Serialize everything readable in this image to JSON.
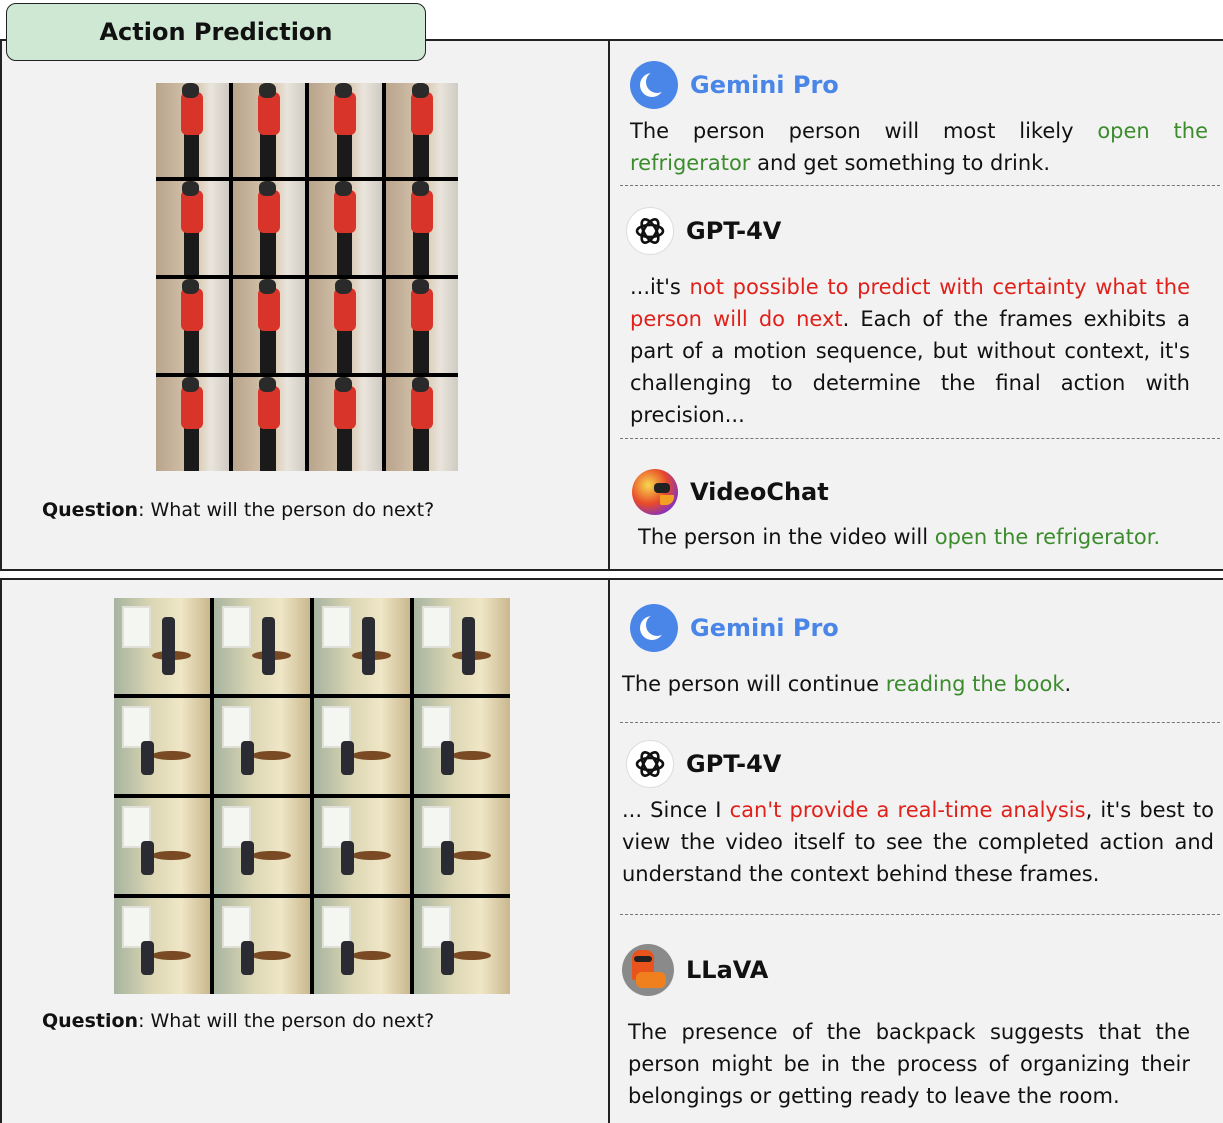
{
  "title": "Action Prediction",
  "question_label": "Question",
  "question_text": ": What will the person do next?",
  "models": {
    "gemini": "Gemini Pro",
    "gpt": "GPT-4V",
    "videochat": "VideoChat",
    "llava": "LLaVA"
  },
  "example1": {
    "gemini": {
      "pre": "The person person will most likely ",
      "hl": "open the refrigerator",
      "post": " and get something to drink."
    },
    "gpt": {
      "pre": "...it's ",
      "hl": "not possible to predict with certainty what the person will do next",
      "post": ". Each of the frames exhibits a part of a motion sequence, but without context, it's challenging to determine the final action with precision..."
    },
    "videochat": {
      "pre": "The person in the video will ",
      "hl": "open the refrigerator.",
      "post": ""
    }
  },
  "example2": {
    "gemini": {
      "pre": "The person will continue ",
      "hl": "reading the book",
      "post": "."
    },
    "gpt": {
      "pre": "... Since I ",
      "hl": "can't provide a real-time analysis",
      "post": ", it's best to view the video itself to see the completed action and understand the context behind these frames."
    },
    "llava": {
      "text": "The presence of the backpack suggests that the person might be in the process of organizing their belongings or getting ready to leave the room."
    }
  },
  "colors": {
    "highlight_green": "#3c8c2e",
    "highlight_red": "#e0201a",
    "gemini_blue": "#4a86e8",
    "title_bg": "#cfe8d3"
  }
}
